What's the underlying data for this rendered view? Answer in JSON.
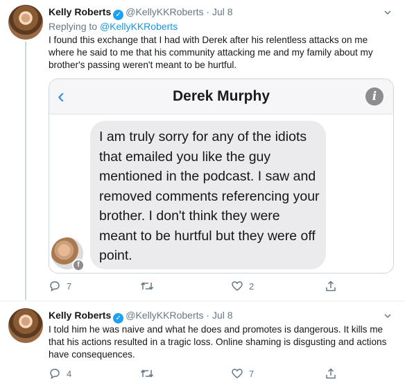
{
  "tweets": [
    {
      "name": "Kelly Roberts",
      "handle": "@KellyKKRoberts",
      "dot": "·",
      "date": "Jul 8",
      "replying_prefix": "Replying to",
      "replying_to": "@KellyKKRoberts",
      "text": "I found this exchange that I had with Derek after his relentless attacks on me where he said to me that his community attacking me and my family about my brother's passing weren't meant to be hurtful.",
      "embed": {
        "contact_name": "Derek Murphy",
        "message": "I am truly sorry for any of the idiots that emailed you like the guy mentioned in the podcast. I saw and removed comments referencing your brother. I don't think they were meant to be hurtful but they were off point."
      },
      "stats": {
        "replies": "7",
        "retweets": "",
        "likes": "2"
      }
    },
    {
      "name": "Kelly Roberts",
      "handle": "@KellyKKRoberts",
      "dot": "·",
      "date": "Jul 8",
      "text": "I told him he was naive and what he does and promotes is dangerous. It kills me that his actions resulted in a tragic loss. Online shaming is disgusting and actions have consequences.",
      "stats": {
        "replies": "4",
        "retweets": "",
        "likes": "7"
      }
    }
  ],
  "icons": {
    "verified": "verified-badge-icon",
    "reply": "reply-icon",
    "retweet": "retweet-icon",
    "like": "heart-icon",
    "share": "share-icon",
    "more": "chevron-down-icon",
    "back": "chevron-left-icon",
    "info": "info-icon"
  },
  "colors": {
    "accent": "#1da1f2",
    "link": "#1b95e0",
    "muted": "#657786",
    "bubble": "#ebebed"
  }
}
